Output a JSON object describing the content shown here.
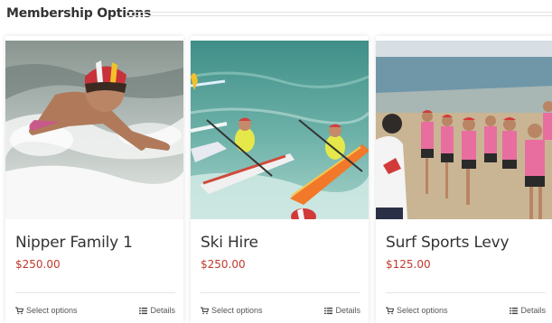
{
  "section": {
    "title": "Membership Options"
  },
  "colors": {
    "price": "#c0392b",
    "text": "#333333",
    "rule": "#e2e2e2"
  },
  "products": [
    {
      "title": "Nipper Family 1",
      "price": "$250.00",
      "select_label": "Select options",
      "details_label": "Details",
      "image": "child-swimming-photo"
    },
    {
      "title": "Ski Hire",
      "price": "$250.00",
      "select_label": "Select options",
      "details_label": "Details",
      "image": "surf-ski-paddlers-photo"
    },
    {
      "title": "Surf Sports Levy",
      "price": "$125.00",
      "select_label": "Select options",
      "details_label": "Details",
      "image": "nippers-group-beach-photo"
    }
  ],
  "icons": {
    "select": "cart-icon",
    "details": "list-icon"
  }
}
